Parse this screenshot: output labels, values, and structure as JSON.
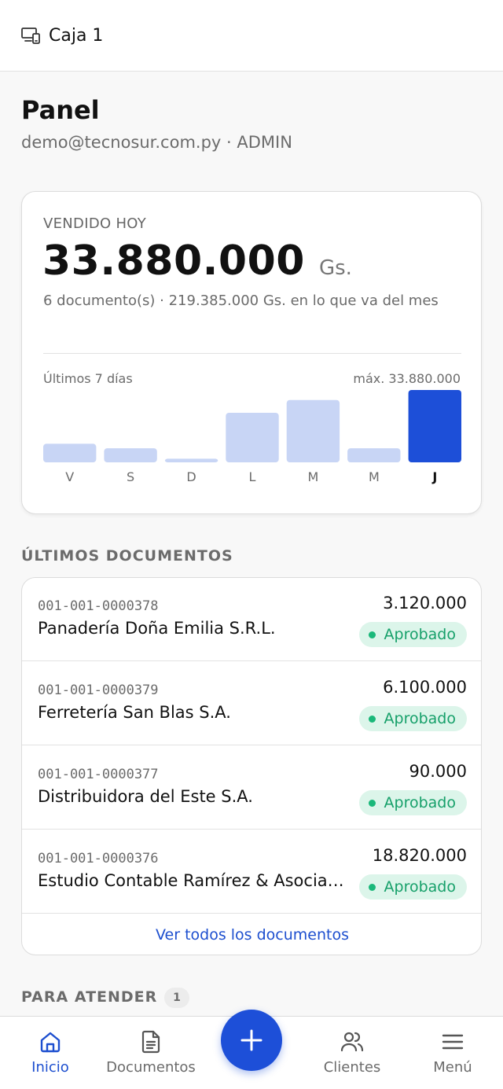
{
  "topbar": {
    "title": "Caja 1",
    "icon": "device-icon"
  },
  "header": {
    "title": "Panel",
    "subtitle": "demo@tecnosur.com.py · ADMIN"
  },
  "sales": {
    "label": "VENDIDO HOY",
    "amount": "33.880.000",
    "currency": "Gs.",
    "detail": "6 documento(s) · 219.385.000 Gs. en lo que va del mes",
    "chart_caption": "Últimos 7 días",
    "chart_max_label": "máx. 33.880.000"
  },
  "chart_data": {
    "type": "bar",
    "categories": [
      "V",
      "S",
      "D",
      "L",
      "M",
      "M",
      "J"
    ],
    "values": [
      8700000,
      6600000,
      1700000,
      23200000,
      29200000,
      6600000,
      33880000
    ],
    "ylim": [
      0,
      33880000
    ],
    "highlight_index": 6,
    "colors": {
      "bar": "#c8d5f5",
      "highlight": "#1d4fd8"
    }
  },
  "documents": {
    "section_title": "ÚLTIMOS DOCUMENTOS",
    "items": [
      {
        "number": "001-001-0000378",
        "client": "Panadería Doña Emilia S.R.L.",
        "total": "3.120.000",
        "status": "Aprobado"
      },
      {
        "number": "001-001-0000379",
        "client": "Ferretería San Blas S.A.",
        "total": "6.100.000",
        "status": "Aprobado"
      },
      {
        "number": "001-001-0000377",
        "client": "Distribuidora del Este S.A.",
        "total": "90.000",
        "status": "Aprobado"
      },
      {
        "number": "001-001-0000376",
        "client": "Estudio Contable Ramírez & Asociados",
        "total": "18.820.000",
        "status": "Aprobado"
      }
    ],
    "see_all": "Ver todos los documentos"
  },
  "attend": {
    "section_title": "PARA ATENDER",
    "count": "1"
  },
  "nav": {
    "items": [
      {
        "label": "Inicio",
        "icon": "home-icon",
        "active": true
      },
      {
        "label": "Documentos",
        "icon": "document-icon"
      },
      {
        "label": "Clientes",
        "icon": "users-icon"
      },
      {
        "label": "Menú",
        "icon": "menu-icon"
      }
    ],
    "fab_icon": "plus-icon"
  },
  "colors": {
    "accent": "#1d4fd8",
    "success": "#16a06a",
    "success_bg": "#dcf5ea"
  }
}
